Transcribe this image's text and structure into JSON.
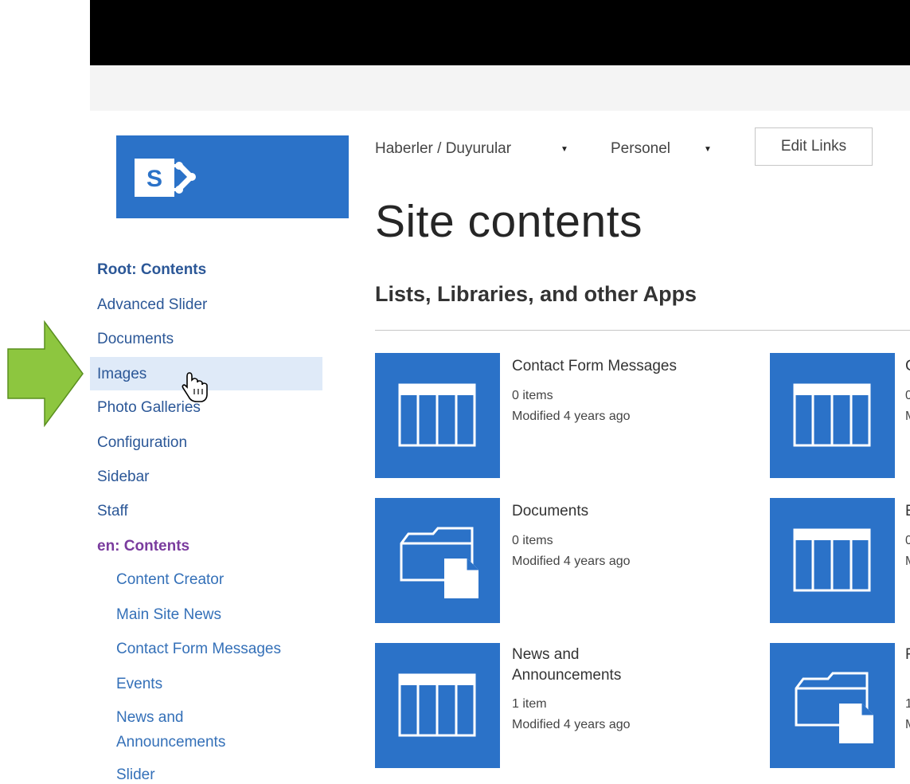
{
  "top_nav": {
    "items": [
      {
        "label": "Haberler / Duyurular"
      },
      {
        "label": "Personel"
      }
    ],
    "edit_links": "Edit Links"
  },
  "page_title": "Site contents",
  "section_title": "Lists, Libraries, and other Apps",
  "left_nav": {
    "root_heading": "Root: Contents",
    "root_items": [
      "Advanced Slider",
      "Documents",
      "Images",
      "Photo Galleries",
      "Configuration",
      "Sidebar",
      "Staff"
    ],
    "en_heading": "en: Contents",
    "en_items": [
      "Content Creator",
      "Main Site News",
      "Contact Form Messages",
      "Events",
      "News and",
      "Announcements",
      "Slider"
    ],
    "selected": "Images"
  },
  "tiles": [
    {
      "title": "Contact Form Messages",
      "count": "0 items",
      "modified": "Modified 4 years ago",
      "icon": "list-icon"
    },
    {
      "title": "Documents",
      "count": "0 items",
      "modified": "Modified 4 years ago",
      "icon": "folder-document-icon"
    },
    {
      "title_line1": "News and",
      "title_line2": "Announcements",
      "count": "1 item",
      "modified": "Modified 4 years ago",
      "icon": "list-icon"
    }
  ],
  "partial_tiles": [
    {
      "title": "C",
      "count": "0",
      "modified": "M",
      "icon": "list-icon"
    },
    {
      "title": "E",
      "count": "0",
      "modified": "M",
      "icon": "list-icon"
    },
    {
      "title": "F",
      "count": "1",
      "modified": "M",
      "icon": "folder-document-icon"
    }
  ],
  "colors": {
    "brand_blue": "#2b72c8",
    "arrow_green": "#8dc63f",
    "nav_highlight": "#dfeaf8"
  }
}
